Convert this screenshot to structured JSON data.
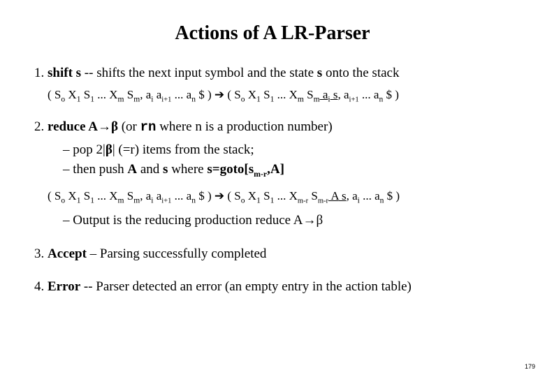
{
  "title": "Actions of A LR-Parser",
  "items": {
    "i1": {
      "lead_bold": "shift s",
      "rest": "  -- shifts the next input symbol and the state ",
      "s_bold": "s",
      "tail": " onto the stack",
      "stack_left_open": "( S",
      "so": "o",
      "x1": " X",
      "s1": "1",
      "sstate1": " S",
      "dots_left": " ... X",
      "m": "m",
      "sm": " S",
      "comma": ", a",
      "i": "i",
      "aip1": " a",
      "ip1": "i+1",
      "dots_a": " ... a",
      "n": "n",
      "dollar_close": " $ )  ",
      "arrow": "➔",
      "open2": "  ( S",
      "shift_ai_s": " s",
      "close2": " $ )"
    },
    "i2": {
      "lead_bold1": "reduce A",
      "arrow_sym": "→",
      "lead_bold2": "β",
      "paren_open": "   (or ",
      "rn": "rn",
      "paren_rest": " where n is a production number)",
      "sub1a": "pop 2|",
      "sub1b": "β",
      "sub1c": "|  (=r) items from the stack;",
      "sub2a": "then push ",
      "sub2A": "A",
      "sub2b": " and ",
      "sub2s": "s",
      "sub2c": "  where  ",
      "sub2goto": "s=goto[s",
      "sub2mr": "m-r",
      "sub2end": ",A]",
      "stack_mr": "m-r",
      "stack_A": " A",
      "stack_s": " s",
      "out_a": "Output is the reducing production reduce A",
      "out_b": "β"
    },
    "i3": {
      "lead_bold": "Accept",
      "rest": " – Parsing successfully completed"
    },
    "i4": {
      "lead_bold": "Error",
      "rest": "  -- Parser detected an error (an empty entry in the action table)"
    }
  },
  "pagenum": "179"
}
